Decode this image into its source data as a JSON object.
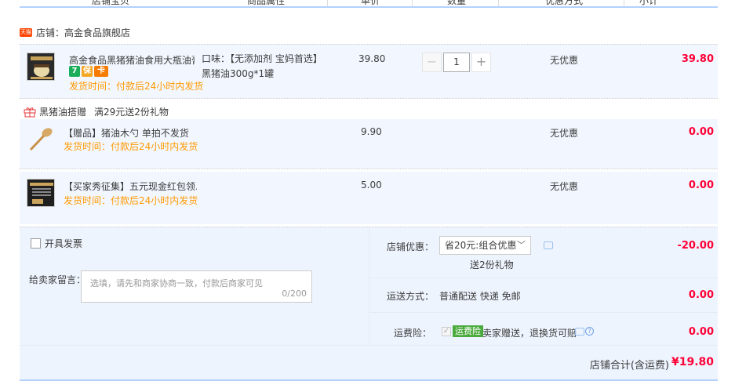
{
  "header": {
    "columns": [
      "店铺宝贝",
      "商品属性",
      "单价",
      "数量",
      "优惠方式",
      "小计"
    ]
  },
  "shop": {
    "badge": "天猫",
    "label": "店铺：高金食品旗舰店"
  },
  "main_item": {
    "title": "高金食品黑猪猪油食用大瓶油膏...",
    "sku": "口味：【无添加剂 宝妈首选】黑猪油300g*1罐",
    "ship": "发货时间：付款后24小时内发货",
    "price": "39.80",
    "quantity": "1",
    "promo": "无优惠",
    "subtotal": "39.80",
    "tags": [
      "7",
      "保",
      "卡"
    ]
  },
  "gift_section": {
    "title": "黑猪油搭赠",
    "rule": "满29元送2份礼物"
  },
  "gifts": [
    {
      "title": "【赠品】猪油木勺 单拍不发货",
      "ship": "发货时间：付款后24小时内发货",
      "price": "9.90",
      "promo": "无优惠",
      "subtotal": "0.00"
    },
    {
      "title": "【买家秀征集】五元现金红包领...",
      "ship": "发货时间：付款后24小时内发货",
      "price": "5.00",
      "promo": "无优惠",
      "subtotal": "0.00"
    }
  ],
  "order": {
    "invoice_label": "开具发票",
    "message_label": "给卖家留言：",
    "message_placeholder": "选填，请先和商家协商一致，付款后商家可见",
    "message_count": "0/200",
    "coupon_label": "店铺优惠：",
    "coupon_value": "省20元:组合优惠",
    "coupon_sub": "送2份礼物",
    "coupon_amount": "-20.00",
    "shipping_label": "运送方式：",
    "shipping_value": "普通配送 快递 免邮",
    "shipping_amount": "0.00",
    "insurance_label": "运费险：",
    "insurance_badge": "运费险",
    "insurance_text": "卖家赠送，退换货可赔",
    "insurance_amount": "0.00",
    "total_label": "店铺合计(含运费)",
    "total_amount": "¥19.80"
  },
  "colors": {
    "accent_red": "#ff0036",
    "ship_orange": "#ff9900",
    "row_blue": "#f2f7ff"
  }
}
